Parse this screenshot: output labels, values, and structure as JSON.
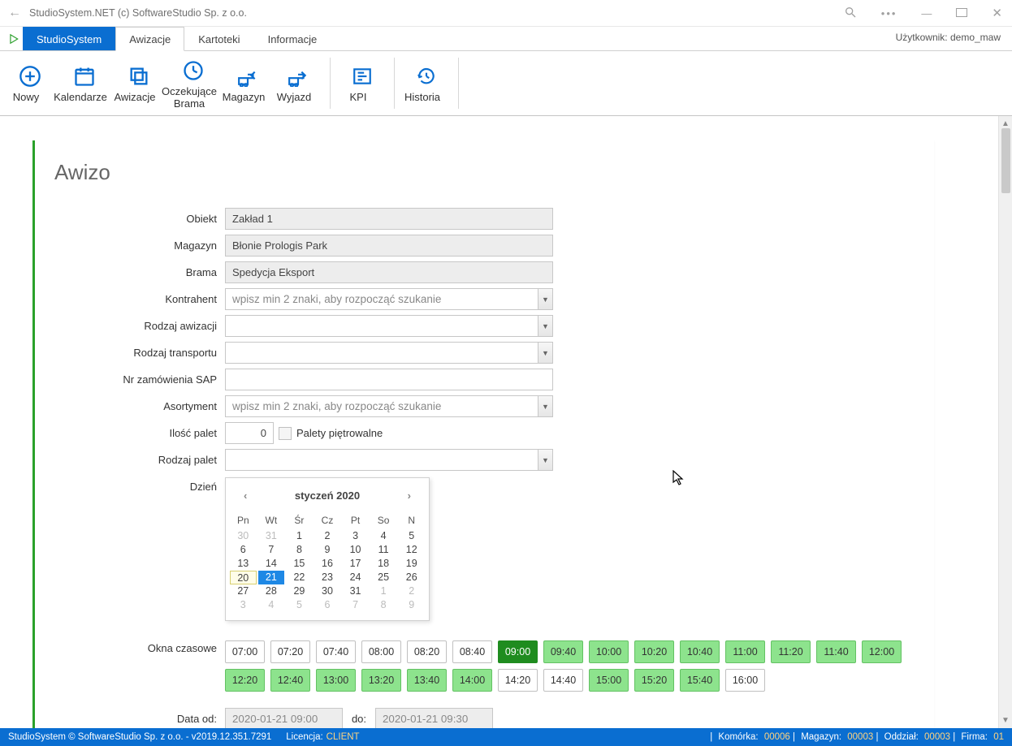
{
  "window": {
    "title": "StudioSystem.NET (c) SoftwareStudio Sp. z o.o."
  },
  "tabs": {
    "primary": "StudioSystem",
    "items": [
      "Awizacje",
      "Kartoteki",
      "Informacje"
    ],
    "active_index": 0,
    "user_label": "Użytkownik: demo_maw"
  },
  "ribbon": {
    "group1": [
      {
        "label": "Nowy",
        "icon": "plus-circle-icon"
      },
      {
        "label": "Kalendarze",
        "icon": "calendar-icon"
      },
      {
        "label": "Awizacje",
        "icon": "copy-icon"
      },
      {
        "label": "Oczekujące\nBrama",
        "icon": "clock-icon"
      },
      {
        "label": "Magazyn",
        "icon": "warehouse-in-icon"
      },
      {
        "label": "Wyjazd",
        "icon": "warehouse-out-icon"
      }
    ],
    "group2": [
      {
        "label": "KPI",
        "icon": "bars-icon"
      }
    ],
    "group3": [
      {
        "label": "Historia",
        "icon": "history-icon"
      }
    ]
  },
  "page": {
    "heading": "Awizo",
    "labels": {
      "obiekt": "Obiekt",
      "magazyn": "Magazyn",
      "brama": "Brama",
      "kontrahent": "Kontrahent",
      "rodzaj_awizacji": "Rodzaj awizacji",
      "rodzaj_transportu": "Rodzaj transportu",
      "nr_zam": "Nr zamówienia SAP",
      "asortyment": "Asortyment",
      "ilosc_palet": "Ilość palet",
      "palety_pietrowalne": "Palety piętrowalne",
      "rodzaj_palet": "Rodzaj palet",
      "dzien": "Dzień",
      "okna": "Okna czasowe",
      "data_od": "Data od:",
      "do": "do:"
    },
    "values": {
      "obiekt": "Zakład 1",
      "magazyn": "Błonie Prologis Park",
      "brama": "Spedycja Eksport",
      "kontrahent_placeholder": "wpisz min 2 znaki, aby rozpocząć szukanie",
      "rodzaj_awizacji": "",
      "rodzaj_transportu": "",
      "nr_zam": "",
      "asortyment_placeholder": "wpisz min 2 znaki, aby rozpocząć szukanie",
      "ilosc_palet": "0",
      "rodzaj_palet": "",
      "data_od": "2020-01-21 09:00",
      "data_do": "2020-01-21 09:30"
    },
    "calendar": {
      "month_label": "styczeń 2020",
      "dow": [
        "Pn",
        "Wt",
        "Śr",
        "Cz",
        "Pt",
        "So",
        "N"
      ],
      "days": [
        {
          "d": "30",
          "other": true
        },
        {
          "d": "31",
          "other": true
        },
        {
          "d": "1"
        },
        {
          "d": "2"
        },
        {
          "d": "3"
        },
        {
          "d": "4"
        },
        {
          "d": "5"
        },
        {
          "d": "6"
        },
        {
          "d": "7"
        },
        {
          "d": "8"
        },
        {
          "d": "9"
        },
        {
          "d": "10"
        },
        {
          "d": "11"
        },
        {
          "d": "12"
        },
        {
          "d": "13"
        },
        {
          "d": "14"
        },
        {
          "d": "15"
        },
        {
          "d": "16"
        },
        {
          "d": "17"
        },
        {
          "d": "18"
        },
        {
          "d": "19"
        },
        {
          "d": "20",
          "today": true
        },
        {
          "d": "21",
          "selected": true
        },
        {
          "d": "22"
        },
        {
          "d": "23"
        },
        {
          "d": "24"
        },
        {
          "d": "25"
        },
        {
          "d": "26"
        },
        {
          "d": "27"
        },
        {
          "d": "28"
        },
        {
          "d": "29"
        },
        {
          "d": "30"
        },
        {
          "d": "31"
        },
        {
          "d": "1",
          "other": true
        },
        {
          "d": "2",
          "other": true
        },
        {
          "d": "3",
          "other": true
        },
        {
          "d": "4",
          "other": true
        },
        {
          "d": "5",
          "other": true
        },
        {
          "d": "6",
          "other": true
        },
        {
          "d": "7",
          "other": true
        },
        {
          "d": "8",
          "other": true
        },
        {
          "d": "9",
          "other": true
        }
      ]
    },
    "slots": [
      {
        "t": "07:00",
        "s": "plain"
      },
      {
        "t": "07:20",
        "s": "plain"
      },
      {
        "t": "07:40",
        "s": "plain"
      },
      {
        "t": "08:00",
        "s": "plain"
      },
      {
        "t": "08:20",
        "s": "plain"
      },
      {
        "t": "08:40",
        "s": "plain"
      },
      {
        "t": "09:00",
        "s": "sel"
      },
      {
        "t": "09:40",
        "s": "avail"
      },
      {
        "t": "10:00",
        "s": "avail"
      },
      {
        "t": "10:20",
        "s": "avail"
      },
      {
        "t": "10:40",
        "s": "avail"
      },
      {
        "t": "11:00",
        "s": "avail"
      },
      {
        "t": "11:20",
        "s": "avail"
      },
      {
        "t": "11:40",
        "s": "avail"
      },
      {
        "t": "12:00",
        "s": "avail"
      },
      {
        "t": "12:20",
        "s": "avail"
      },
      {
        "t": "12:40",
        "s": "avail"
      },
      {
        "t": "13:00",
        "s": "avail"
      },
      {
        "t": "13:20",
        "s": "avail"
      },
      {
        "t": "13:40",
        "s": "avail"
      },
      {
        "t": "14:00",
        "s": "avail"
      },
      {
        "t": "14:20",
        "s": "plain"
      },
      {
        "t": "14:40",
        "s": "plain"
      },
      {
        "t": "15:00",
        "s": "avail"
      },
      {
        "t": "15:20",
        "s": "avail"
      },
      {
        "t": "15:40",
        "s": "avail"
      },
      {
        "t": "16:00",
        "s": "plain"
      }
    ]
  },
  "statusbar": {
    "copyright": "StudioSystem © SoftwareStudio Sp. z o.o. - v2019.12.351.7291",
    "licencja_label": "Licencja:",
    "licencja_value": "CLIENT",
    "komorka_label": "Komórka:",
    "komorka_value": "00006",
    "magazyn_label": "Magazyn:",
    "magazyn_value": "00003",
    "oddzial_label": "Oddział:",
    "oddzial_value": "00003",
    "firma_label": "Firma:",
    "firma_value": "01"
  }
}
